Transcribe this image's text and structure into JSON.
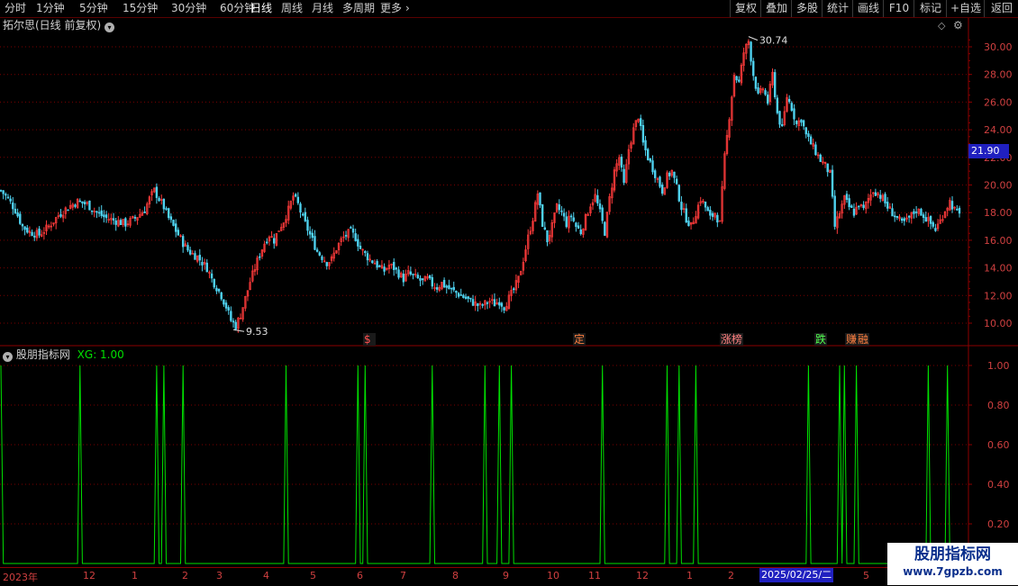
{
  "toolbar": {
    "periods": [
      "分时",
      "1分钟",
      "5分钟",
      "15分钟",
      "30分钟",
      "60分钟",
      "日线",
      "周线",
      "月线",
      "多周期",
      "更多"
    ],
    "active_period": "日线",
    "right_buttons": [
      "复权",
      "叠加",
      "多股",
      "统计",
      "画线",
      "F10",
      "标记",
      "+自选",
      "返回"
    ]
  },
  "main_panel": {
    "title": "拓尔思(日线 前复权)",
    "y_ticks": [
      "30.00",
      "28.00",
      "26.00",
      "24.00",
      "22.00",
      "20.00",
      "18.00",
      "16.00",
      "14.00",
      "12.00",
      "10.00"
    ],
    "current_price": "21.90",
    "high_label": "30.74",
    "low_label": "9.53",
    "event_labels": [
      "$",
      "定",
      "涨榜",
      "跌",
      "赚",
      "融"
    ],
    "colors": {
      "up": "#ff3b3b",
      "down": "#4fd2f0",
      "grid": "#7a0000",
      "axis": "#8b0000"
    }
  },
  "indicator_panel": {
    "title": "股朋指标网",
    "value_label": "XG: 1.00",
    "y_ticks": [
      "1.00",
      "0.80",
      "0.60",
      "0.40",
      "0.20"
    ],
    "line_color": "#00e000"
  },
  "time_axis": {
    "labels": [
      "2023年",
      "12",
      "1",
      "2",
      "3",
      "4",
      "5",
      "6",
      "7",
      "8",
      "9",
      "10",
      "11",
      "12",
      "1",
      "2",
      "5"
    ],
    "cursor_date": "2025/02/25/二"
  },
  "chart_data": {
    "type": "candlestick",
    "title": "拓尔思(日线 前复权)",
    "ylim": [
      9,
      31.5
    ],
    "high": 30.74,
    "low": 9.53,
    "current": 21.9,
    "close_path": [
      [
        0,
        19.6
      ],
      [
        3,
        19.0
      ],
      [
        6,
        18.2
      ],
      [
        9,
        17.0
      ],
      [
        12,
        16.6
      ],
      [
        16,
        16.4
      ],
      [
        20,
        17.0
      ],
      [
        24,
        17.8
      ],
      [
        28,
        18.4
      ],
      [
        32,
        18.8
      ],
      [
        36,
        18.6
      ],
      [
        40,
        18.0
      ],
      [
        44,
        17.6
      ],
      [
        48,
        17.4
      ],
      [
        52,
        17.2
      ],
      [
        56,
        17.6
      ],
      [
        60,
        18.2
      ],
      [
        62,
        19.0
      ],
      [
        64,
        19.6
      ],
      [
        66,
        19.0
      ],
      [
        68,
        18.4
      ],
      [
        70,
        17.6
      ],
      [
        72,
        17.0
      ],
      [
        74,
        16.4
      ],
      [
        76,
        15.8
      ],
      [
        78,
        15.3
      ],
      [
        80,
        15.0
      ],
      [
        82,
        14.8
      ],
      [
        84,
        14.4
      ],
      [
        86,
        14.0
      ],
      [
        88,
        13.2
      ],
      [
        90,
        12.6
      ],
      [
        92,
        12.0
      ],
      [
        94,
        11.2
      ],
      [
        96,
        10.2
      ],
      [
        98,
        9.8
      ],
      [
        100,
        10.6
      ],
      [
        102,
        11.8
      ],
      [
        104,
        13.0
      ],
      [
        106,
        14.0
      ],
      [
        108,
        15.0
      ],
      [
        110,
        15.8
      ],
      [
        112,
        16.4
      ],
      [
        114,
        16.0
      ],
      [
        116,
        16.8
      ],
      [
        118,
        17.4
      ],
      [
        120,
        18.2
      ],
      [
        122,
        19.2
      ],
      [
        124,
        18.6
      ],
      [
        126,
        17.6
      ],
      [
        128,
        16.8
      ],
      [
        130,
        16.0
      ],
      [
        132,
        15.2
      ],
      [
        134,
        14.8
      ],
      [
        136,
        14.4
      ],
      [
        138,
        14.6
      ],
      [
        140,
        15.4
      ],
      [
        142,
        16.0
      ],
      [
        144,
        16.4
      ],
      [
        146,
        16.6
      ],
      [
        148,
        16.2
      ],
      [
        150,
        15.4
      ],
      [
        152,
        15.0
      ],
      [
        154,
        14.6
      ],
      [
        156,
        14.4
      ],
      [
        158,
        14.0
      ],
      [
        160,
        13.8
      ],
      [
        162,
        14.2
      ],
      [
        164,
        14.0
      ],
      [
        166,
        13.6
      ],
      [
        168,
        13.2
      ],
      [
        170,
        13.6
      ],
      [
        172,
        13.4
      ],
      [
        174,
        13.2
      ],
      [
        176,
        13.0
      ],
      [
        178,
        13.2
      ],
      [
        180,
        12.8
      ],
      [
        182,
        12.6
      ],
      [
        184,
        12.9
      ],
      [
        186,
        12.6
      ],
      [
        188,
        12.4
      ],
      [
        190,
        12.2
      ],
      [
        192,
        12.0
      ],
      [
        194,
        11.8
      ],
      [
        196,
        11.6
      ],
      [
        198,
        11.4
      ],
      [
        200,
        11.2
      ],
      [
        202,
        11.4
      ],
      [
        204,
        11.6
      ],
      [
        206,
        11.4
      ],
      [
        208,
        11.6
      ],
      [
        210,
        11.2
      ],
      [
        212,
        11.8
      ],
      [
        214,
        12.4
      ],
      [
        216,
        13.2
      ],
      [
        218,
        14.6
      ],
      [
        220,
        16.2
      ],
      [
        222,
        17.6
      ],
      [
        224,
        19.4
      ],
      [
        226,
        17.2
      ],
      [
        228,
        16.0
      ],
      [
        230,
        17.0
      ],
      [
        232,
        18.4
      ],
      [
        234,
        18.0
      ],
      [
        236,
        17.2
      ],
      [
        238,
        17.8
      ],
      [
        240,
        17.0
      ],
      [
        242,
        16.6
      ],
      [
        244,
        17.6
      ],
      [
        246,
        18.6
      ],
      [
        248,
        19.2
      ],
      [
        250,
        18.0
      ],
      [
        252,
        16.6
      ],
      [
        254,
        19.0
      ],
      [
        256,
        21.0
      ],
      [
        258,
        22.0
      ],
      [
        260,
        20.0
      ],
      [
        262,
        22.6
      ],
      [
        264,
        24.0
      ],
      [
        266,
        25.0
      ],
      [
        268,
        23.0
      ],
      [
        270,
        22.0
      ],
      [
        272,
        21.2
      ],
      [
        274,
        20.4
      ],
      [
        276,
        19.6
      ],
      [
        278,
        20.6
      ],
      [
        280,
        21.0
      ],
      [
        282,
        19.8
      ],
      [
        284,
        18.4
      ],
      [
        286,
        17.6
      ],
      [
        288,
        17.0
      ],
      [
        290,
        18.0
      ],
      [
        292,
        19.0
      ],
      [
        294,
        18.4
      ],
      [
        296,
        17.6
      ],
      [
        298,
        18.0
      ],
      [
        300,
        17.2
      ],
      [
        302,
        22.0
      ],
      [
        304,
        25.0
      ],
      [
        306,
        28.0
      ],
      [
        308,
        27.4
      ],
      [
        310,
        29.6
      ],
      [
        312,
        30.4
      ],
      [
        314,
        28.0
      ],
      [
        316,
        26.4
      ],
      [
        318,
        27.0
      ],
      [
        320,
        26.0
      ],
      [
        322,
        28.0
      ],
      [
        324,
        25.2
      ],
      [
        326,
        24.0
      ],
      [
        328,
        26.4
      ],
      [
        330,
        25.6
      ],
      [
        332,
        24.4
      ],
      [
        334,
        24.8
      ],
      [
        336,
        23.6
      ],
      [
        338,
        23.0
      ],
      [
        340,
        22.4
      ],
      [
        342,
        21.8
      ],
      [
        344,
        21.4
      ],
      [
        346,
        20.8
      ],
      [
        348,
        17.0
      ],
      [
        350,
        18.0
      ],
      [
        352,
        19.0
      ],
      [
        354,
        18.4
      ],
      [
        356,
        18.0
      ],
      [
        358,
        18.6
      ],
      [
        360,
        18.2
      ],
      [
        362,
        19.0
      ],
      [
        364,
        19.6
      ],
      [
        366,
        19.4
      ],
      [
        368,
        19.0
      ],
      [
        370,
        18.4
      ],
      [
        372,
        18.0
      ],
      [
        374,
        17.6
      ],
      [
        376,
        17.2
      ],
      [
        378,
        17.4
      ],
      [
        380,
        17.8
      ],
      [
        382,
        18.2
      ],
      [
        384,
        18.0
      ],
      [
        386,
        17.6
      ],
      [
        388,
        17.2
      ],
      [
        390,
        16.8
      ],
      [
        392,
        17.4
      ],
      [
        394,
        18.2
      ],
      [
        396,
        18.8
      ],
      [
        398,
        18.2
      ],
      [
        400,
        17.8
      ]
    ],
    "indicator": {
      "name": "XG",
      "value": 1.0,
      "ylim": [
        0,
        1.05
      ],
      "signal_indices": [
        0,
        33,
        65,
        68,
        76,
        119,
        149,
        152,
        180,
        202,
        208,
        213,
        251,
        278,
        283,
        290,
        337,
        350,
        352,
        357,
        387,
        395
      ]
    }
  }
}
